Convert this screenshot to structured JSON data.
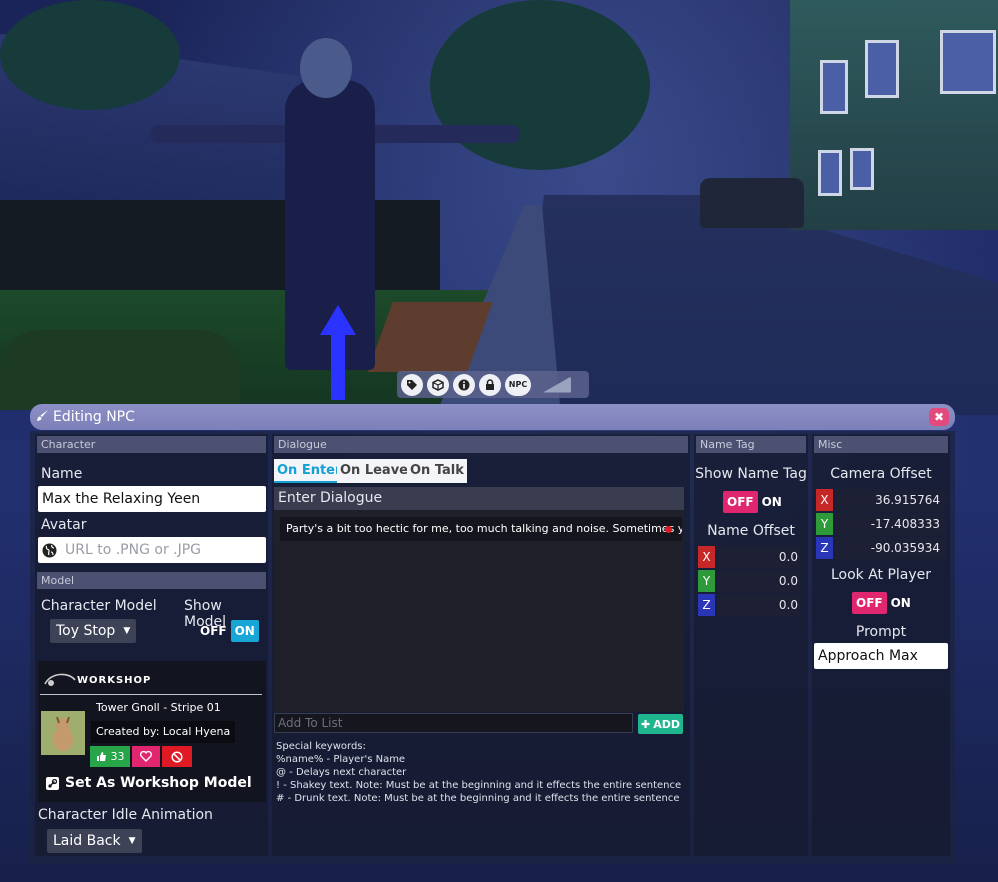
{
  "toolbar": {
    "icons": [
      "tag-icon",
      "cube-icon",
      "info-icon",
      "lock-icon",
      "npc-icon",
      "terrain-icon"
    ],
    "npc_label": "NPC"
  },
  "window": {
    "title": "Editing NPC",
    "close_glyph": "✖"
  },
  "character": {
    "header": "Character",
    "name_label": "Name",
    "name_value": "Max the Relaxing Yeen",
    "avatar_label": "Avatar",
    "avatar_placeholder": "URL to .PNG or .JPG"
  },
  "model": {
    "header": "Model",
    "character_model_label": "Character Model",
    "show_model_label": "Show Model",
    "character_model_value": "Toy Stop",
    "show_model_off": "OFF",
    "show_model_on": "ON",
    "show_model_state": "ON",
    "workshop": {
      "logo_text": "WORKSHOP",
      "item_name": "Tower Gnoll - Stripe 01",
      "created_by": "Created by: Local Hyena",
      "likes": "33",
      "set_button": "Set As Workshop Model"
    },
    "idle_label": "Character Idle Animation",
    "idle_value": "Laid Back"
  },
  "dialogue": {
    "header": "Dialogue",
    "tabs": [
      "On Enter",
      "On Leave",
      "On Talk"
    ],
    "active_tab": "On Enter",
    "enter_label": "Enter Dialogue",
    "entries": [
      "Party's a bit too hectic for me, too much talking and noise. Sometimes you just need"
    ],
    "add_placeholder": "Add To List",
    "add_button": "ADD",
    "keywords": [
      "Special keywords:",
      "%name% - Player's Name",
      "@ - Delays next character",
      "! - Shakey text. Note: Must be at the beginning and it effects the entire sentence",
      "# - Drunk text. Note: Must be at the beginning and it effects the entire sentence"
    ]
  },
  "name_tag": {
    "header": "Name Tag",
    "show_label": "Show Name Tag",
    "off": "OFF",
    "on": "ON",
    "state": "OFF",
    "offset_label": "Name Offset",
    "x": "0.0",
    "y": "0.0",
    "z": "0.0"
  },
  "misc": {
    "header": "Misc",
    "camera_label": "Camera Offset",
    "x": "36.915764",
    "y": "-17.408333",
    "z": "-90.035934",
    "look_label": "Look At Player",
    "off": "OFF",
    "on": "ON",
    "look_state": "OFF",
    "prompt_label": "Prompt",
    "prompt_value": "Approach Max"
  },
  "axes": {
    "x": "X",
    "y": "Y",
    "z": "Z"
  },
  "colors": {
    "accent": "#17a6d6",
    "off_pink": "#e0266f",
    "add_green": "#1fb58f",
    "title_bar": "#8c90c6"
  }
}
